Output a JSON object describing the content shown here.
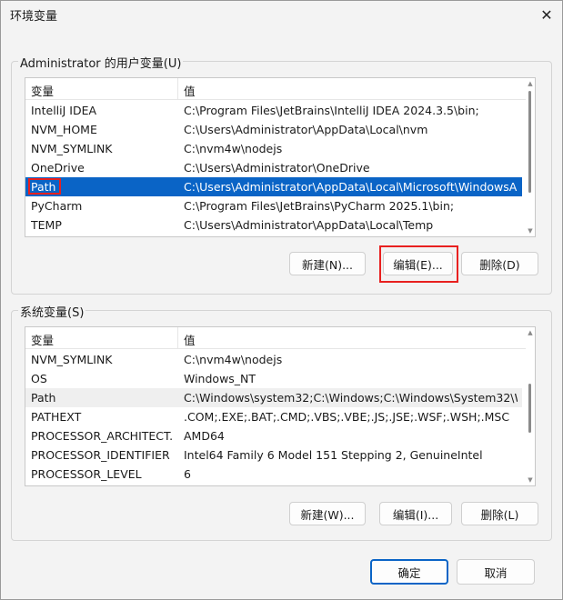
{
  "window": {
    "title": "环境变量",
    "close_glyph": "✕"
  },
  "user_vars": {
    "group_label": "Administrator 的用户变量(U)",
    "columns": [
      "变量",
      "值"
    ],
    "rows": [
      {
        "name": "IntelliJ IDEA",
        "value": "C:\\Program Files\\JetBrains\\IntelliJ IDEA 2024.3.5\\bin;"
      },
      {
        "name": "NVM_HOME",
        "value": "C:\\Users\\Administrator\\AppData\\Local\\nvm"
      },
      {
        "name": "NVM_SYMLINK",
        "value": "C:\\nvm4w\\nodejs"
      },
      {
        "name": "OneDrive",
        "value": "C:\\Users\\Administrator\\OneDrive"
      },
      {
        "name": "Path",
        "value": "C:\\Users\\Administrator\\AppData\\Local\\Microsoft\\WindowsA..."
      },
      {
        "name": "PyCharm",
        "value": "C:\\Program Files\\JetBrains\\PyCharm 2025.1\\bin;"
      },
      {
        "name": "TEMP",
        "value": "C:\\Users\\Administrator\\AppData\\Local\\Temp"
      }
    ],
    "buttons": {
      "new": "新建(N)...",
      "edit": "编辑(E)...",
      "delete": "删除(D)"
    }
  },
  "system_vars": {
    "group_label": "系统变量(S)",
    "columns": [
      "变量",
      "值"
    ],
    "rows": [
      {
        "name": "NVM_SYMLINK",
        "value": "C:\\nvm4w\\nodejs"
      },
      {
        "name": "OS",
        "value": "Windows_NT"
      },
      {
        "name": "Path",
        "value": "C:\\Windows\\system32;C:\\Windows;C:\\Windows\\System32\\Wb..."
      },
      {
        "name": "PATHEXT",
        "value": ".COM;.EXE;.BAT;.CMD;.VBS;.VBE;.JS;.JSE;.WSF;.WSH;.MSC"
      },
      {
        "name": "PROCESSOR_ARCHITECT...",
        "value": "AMD64"
      },
      {
        "name": "PROCESSOR_IDENTIFIER",
        "value": "Intel64 Family 6 Model 151 Stepping 2, GenuineIntel"
      },
      {
        "name": "PROCESSOR_LEVEL",
        "value": "6"
      }
    ],
    "buttons": {
      "new": "新建(W)...",
      "edit": "编辑(I)...",
      "delete": "删除(L)"
    }
  },
  "footer": {
    "ok": "确定",
    "cancel": "取消"
  },
  "colors": {
    "selection": "#0a64c6",
    "highlight_box": "#e8201f",
    "default_button_border": "#0a64c6"
  }
}
